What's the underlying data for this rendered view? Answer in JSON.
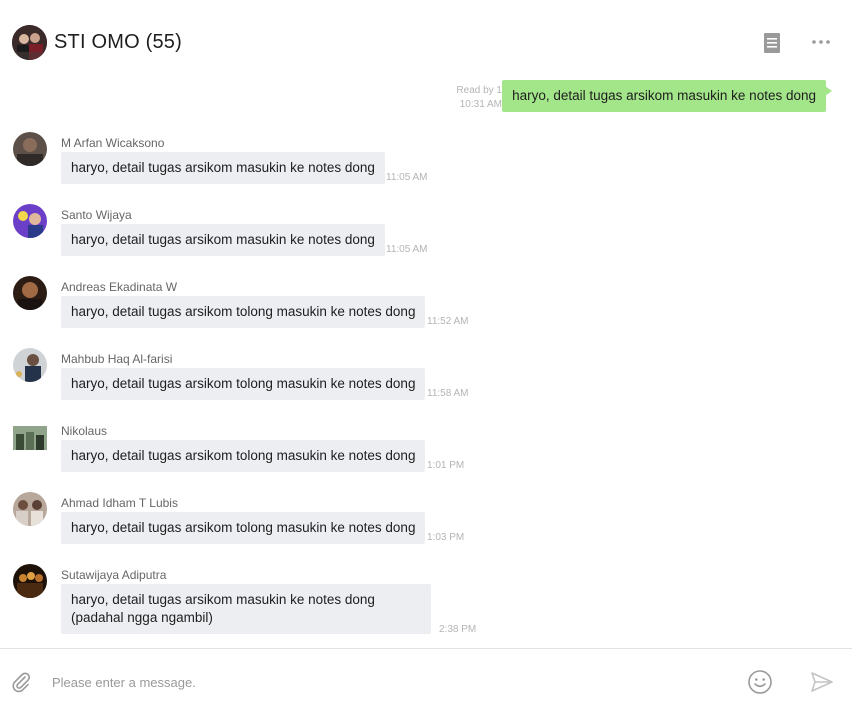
{
  "header": {
    "title": "STI OMO (55)",
    "icons": {
      "notes": "notes-icon",
      "more": "more-icon"
    }
  },
  "own_message": {
    "read_status": "Read by 1",
    "time": "10:31 AM",
    "text": "haryo, detail tugas arsikom masukin ke notes dong",
    "bubble_color": "#a3e589"
  },
  "messages": [
    {
      "sender": "M Arfan Wicaksono",
      "text": "haryo, detail tugas arsikom masukin ke notes dong",
      "time": "11:05 AM"
    },
    {
      "sender": "Santo Wijaya",
      "text": "haryo, detail tugas arsikom masukin ke notes dong",
      "time": "11:05 AM"
    },
    {
      "sender": "Andreas Ekadinata W",
      "text": "haryo, detail tugas arsikom tolong masukin ke notes dong",
      "time": "11:52 AM"
    },
    {
      "sender": "Mahbub Haq Al-farisi",
      "text": "haryo, detail tugas arsikom tolong masukin ke notes dong",
      "time": "11:58 AM"
    },
    {
      "sender": "Nikolaus",
      "text": "haryo, detail tugas arsikom tolong masukin ke notes dong",
      "time": "1:01 PM"
    },
    {
      "sender": "Ahmad Idham T Lubis",
      "text": "haryo, detail tugas arsikom tolong masukin ke notes dong",
      "time": "1:03 PM"
    },
    {
      "sender": "Sutawijaya Adiputra",
      "text": "haryo, detail tugas arsikom masukin ke notes dong (padahal ngga ngambil)",
      "time": "2:38 PM"
    }
  ],
  "input": {
    "placeholder": "Please enter a message.",
    "icons": {
      "attach": "paperclip-icon",
      "emoji": "smiley-icon",
      "send": "send-icon"
    }
  },
  "colors": {
    "incoming_bubble": "#edeef2",
    "meta_text": "#b4b4b4"
  }
}
